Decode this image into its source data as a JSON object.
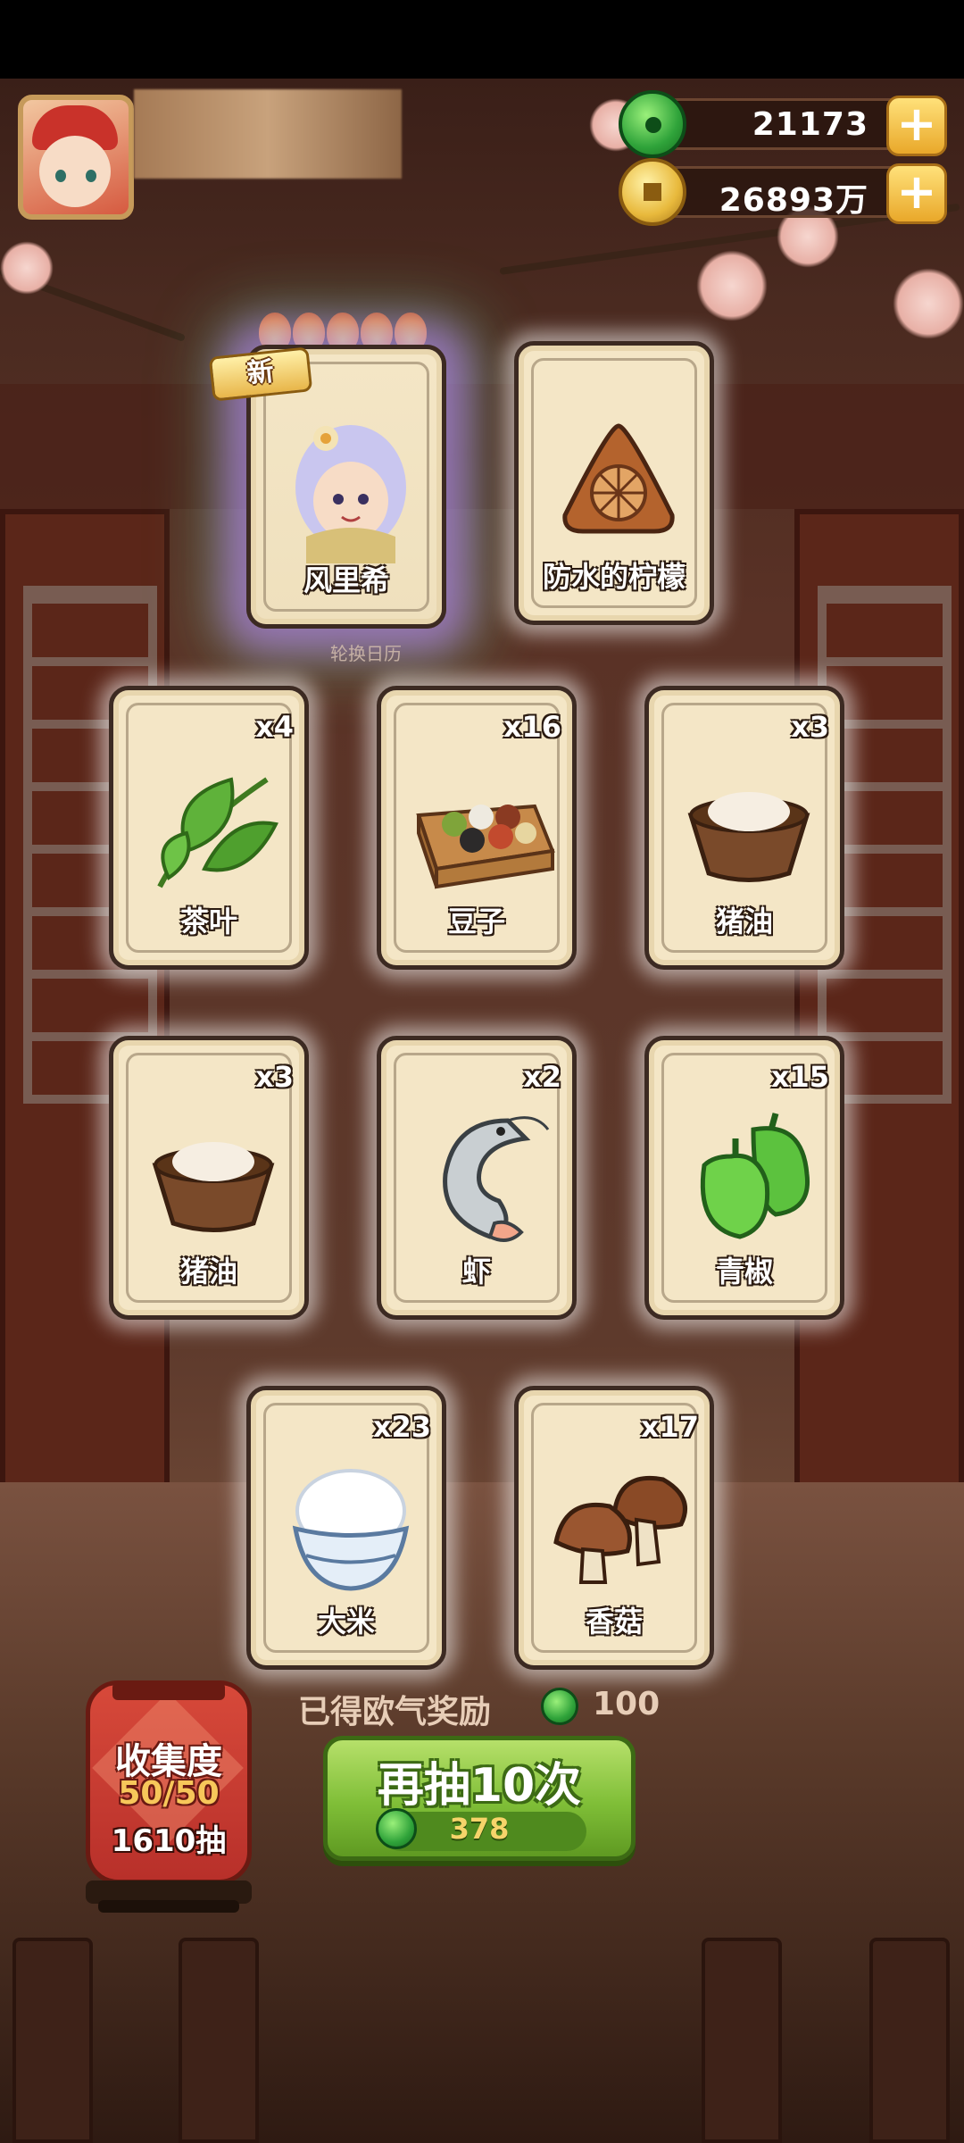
{
  "hud": {
    "jade_amount": "21173",
    "coin_amount": "26893万"
  },
  "featured_cards": [
    {
      "label": "风里希",
      "is_new": true,
      "new_badge": "新",
      "stars": 5
    },
    {
      "label": "防水的柠檬"
    }
  ],
  "calendar_label": "轮换日历",
  "cards": [
    {
      "label": "茶叶",
      "count": "x4"
    },
    {
      "label": "豆子",
      "count": "x16"
    },
    {
      "label": "猪油",
      "count": "x3"
    },
    {
      "label": "猪油",
      "count": "x3"
    },
    {
      "label": "虾",
      "count": "x2"
    },
    {
      "label": "青椒",
      "count": "x15"
    },
    {
      "label": "大米",
      "count": "x23"
    },
    {
      "label": "香菇",
      "count": "x17"
    }
  ],
  "luck_reward": {
    "label": "已得欧气奖励",
    "value": "100"
  },
  "draw_button": {
    "label": "再抽10次",
    "cost": "378"
  },
  "collection": {
    "title": "收集度",
    "progress": "50/50",
    "draws": "1610抽"
  },
  "colors": {
    "accent_green": "#7fbe37",
    "gold": "#e9a82a",
    "card_bg": "#f4e6c6",
    "lantern_red": "#c83a30"
  }
}
